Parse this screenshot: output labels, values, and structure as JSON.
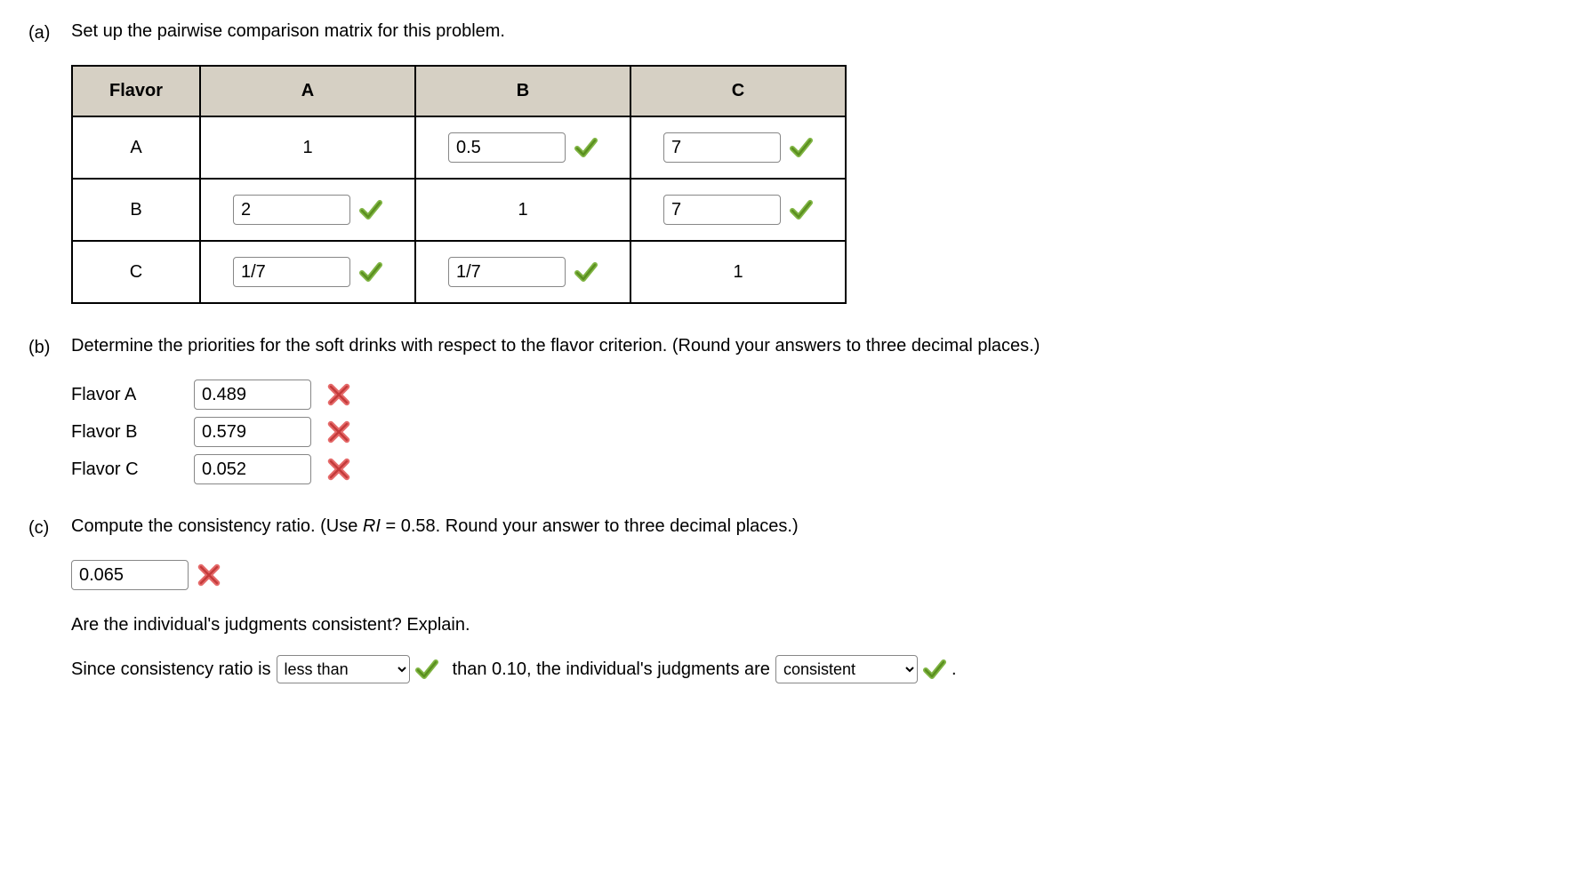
{
  "parts": {
    "a": {
      "label": "(a)",
      "prompt": "Set up the pairwise comparison matrix for this problem."
    },
    "b": {
      "label": "(b)",
      "prompt": "Determine the priorities for the soft drinks with respect to the flavor criterion. (Round your answers to three decimal places.)"
    },
    "c": {
      "label": "(c)",
      "prompt_pre": "Compute the consistency ratio. (Use ",
      "prompt_ri": "RI",
      "prompt_post": " = 0.58. Round your answer to three decimal places.)"
    }
  },
  "matrix": {
    "head": {
      "flavor": "Flavor",
      "A": "A",
      "B": "B",
      "C": "C"
    },
    "rows": [
      {
        "label": "A",
        "cells": [
          {
            "kind": "static",
            "value": "1"
          },
          {
            "kind": "input",
            "value": "0.5",
            "mark": "correct"
          },
          {
            "kind": "input",
            "value": "7",
            "mark": "correct"
          }
        ]
      },
      {
        "label": "B",
        "cells": [
          {
            "kind": "input",
            "value": "2",
            "mark": "correct"
          },
          {
            "kind": "static",
            "value": "1"
          },
          {
            "kind": "input",
            "value": "7",
            "mark": "correct"
          }
        ]
      },
      {
        "label": "C",
        "cells": [
          {
            "kind": "input",
            "value": "1/7",
            "mark": "correct"
          },
          {
            "kind": "input",
            "value": "1/7",
            "mark": "correct"
          },
          {
            "kind": "static",
            "value": "1"
          }
        ]
      }
    ]
  },
  "priorities": [
    {
      "label": "Flavor A",
      "value": "0.489",
      "mark": "incorrect"
    },
    {
      "label": "Flavor B",
      "value": "0.579",
      "mark": "incorrect"
    },
    {
      "label": "Flavor C",
      "value": "0.052",
      "mark": "incorrect"
    }
  ],
  "consistency": {
    "ratio_value": "0.065",
    "ratio_mark": "incorrect",
    "explain_prompt": "Are the individual's judgments consistent? Explain.",
    "sentence": {
      "pre": "Since consistency ratio is ",
      "comp_value": "less than",
      "comp_mark": "correct",
      "mid": " than 0.10, the individual's judgments are ",
      "judg_value": "consistent",
      "judg_mark": "correct",
      "post": "  ."
    }
  }
}
